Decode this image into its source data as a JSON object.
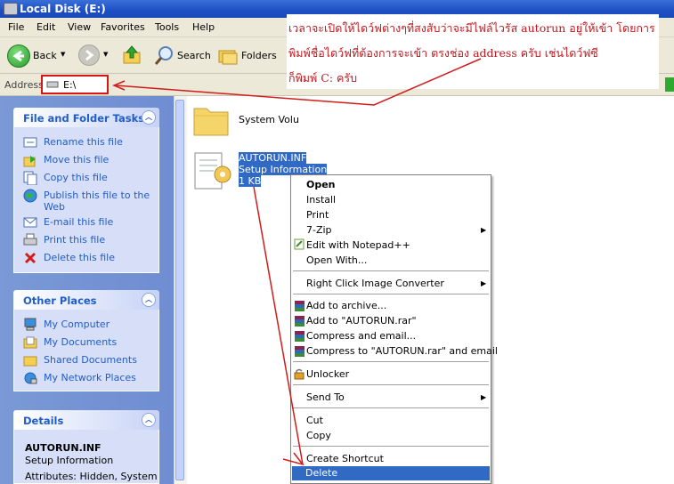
{
  "window": {
    "title": "Local Disk (E:)"
  },
  "menu": [
    "File",
    "Edit",
    "View",
    "Favorites",
    "Tools",
    "Help"
  ],
  "toolbar": {
    "back": "Back",
    "search": "Search",
    "folders": "Folders"
  },
  "address": {
    "label": "Address",
    "value": "E:\\"
  },
  "tasks": {
    "title": "File and Folder Tasks",
    "items": [
      "Rename this file",
      "Move this file",
      "Copy this file",
      "Publish this file to the",
      "Web",
      "E-mail this file",
      "Print this file",
      "Delete this file"
    ]
  },
  "other_places": {
    "title": "Other Places",
    "items": [
      "My Computer",
      "My Documents",
      "Shared Documents",
      "My Network Places"
    ]
  },
  "details": {
    "title": "Details",
    "name": "AUTORUN.INF",
    "type": "Setup Information",
    "attributes": "Attributes: Hidden, System"
  },
  "files": [
    {
      "name": "System Volu",
      "kind": "folder-icon"
    },
    {
      "name": "AUTORUN.INF",
      "type": "Setup Information",
      "size": "1 KB",
      "kind": "inf-file-icon"
    }
  ],
  "context_menu": {
    "items": [
      "Open",
      "Install",
      "Print",
      "7-Zip",
      "Edit with Notepad++",
      "Open With...",
      "Right Click Image Converter",
      "Add to archive...",
      "Add to \"AUTORUN.rar\"",
      "Compress and email...",
      "Compress to \"AUTORUN.rar\" and email",
      "Unlocker",
      "Send To",
      "Cut",
      "Copy",
      "Create Shortcut",
      "Delete"
    ]
  },
  "annotation": {
    "lines": [
      "เวลาจะเปิดให้ไดว์ฟต่างๆที่สงสับว่าจะมีไฟล์ไวรัส autorun อยู่ให้เข้า โดยการ",
      "พิมพ์ชื่อไดว์ฟที่ต้องการจะเข้า ตรงช่อง address ครับ เช่นไดว์ฟซี",
      "ก็พิมพ์ C: ครับ"
    ]
  },
  "colors": {
    "annotation": "#c1191f",
    "selection": "#316ac5",
    "xp_blue": "#215dc6"
  }
}
